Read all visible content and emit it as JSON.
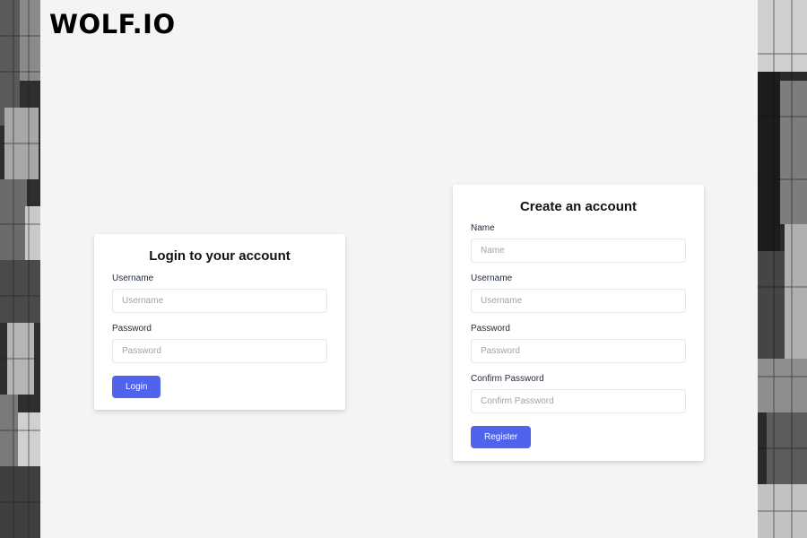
{
  "brand": {
    "logo_text": "WOLF.IO"
  },
  "login": {
    "title": "Login to your account",
    "username_label": "Username",
    "username_placeholder": "Username",
    "password_label": "Password",
    "password_placeholder": "Password",
    "submit_label": "Login"
  },
  "register": {
    "title": "Create an account",
    "name_label": "Name",
    "name_placeholder": "Name",
    "username_label": "Username",
    "username_placeholder": "Username",
    "password_label": "Password",
    "password_placeholder": "Password",
    "confirm_label": "Confirm Password",
    "confirm_placeholder": "Confirm Password",
    "submit_label": "Register"
  },
  "colors": {
    "background": "#f3f4f6",
    "card": "#ffffff",
    "accent": "#4f63ec"
  }
}
